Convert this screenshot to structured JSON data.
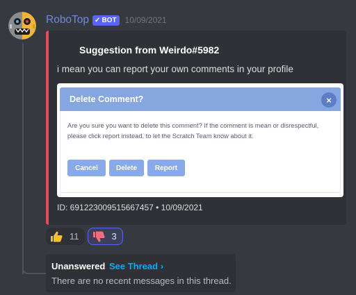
{
  "message": {
    "author": "RoboTop",
    "bot_tag": "BOT",
    "bot_check": "✓",
    "timestamp": "10/09/2021"
  },
  "embed": {
    "title": "Suggestion from Weirdo#5982",
    "description": "i mean you can report your own comments in your profile",
    "footer": "ID: 691223009515667457 • 10/09/2021",
    "accent_color": "#e74c5e",
    "image": {
      "dialog_title": "Delete Comment?",
      "close_glyph": "×",
      "body": "Are you sure you want to delete this comment? If the comment is mean or disrespectful, please click report instead, to let the Scratch Team know about it.",
      "buttons": [
        "Cancel",
        "Delete",
        "Report"
      ]
    }
  },
  "reactions": [
    {
      "emoji": "thumbs-up",
      "count": "11",
      "selected": false
    },
    {
      "emoji": "thumbs-down",
      "count": "3",
      "selected": true
    }
  ],
  "thread": {
    "status": "Unanswered",
    "link": "See Thread ›",
    "empty_text": "There are no recent messages in this thread."
  },
  "colors": {
    "background": "#36393f",
    "username": "#7289da",
    "bot_tag": "#5865f2",
    "link": "#00aff4"
  }
}
